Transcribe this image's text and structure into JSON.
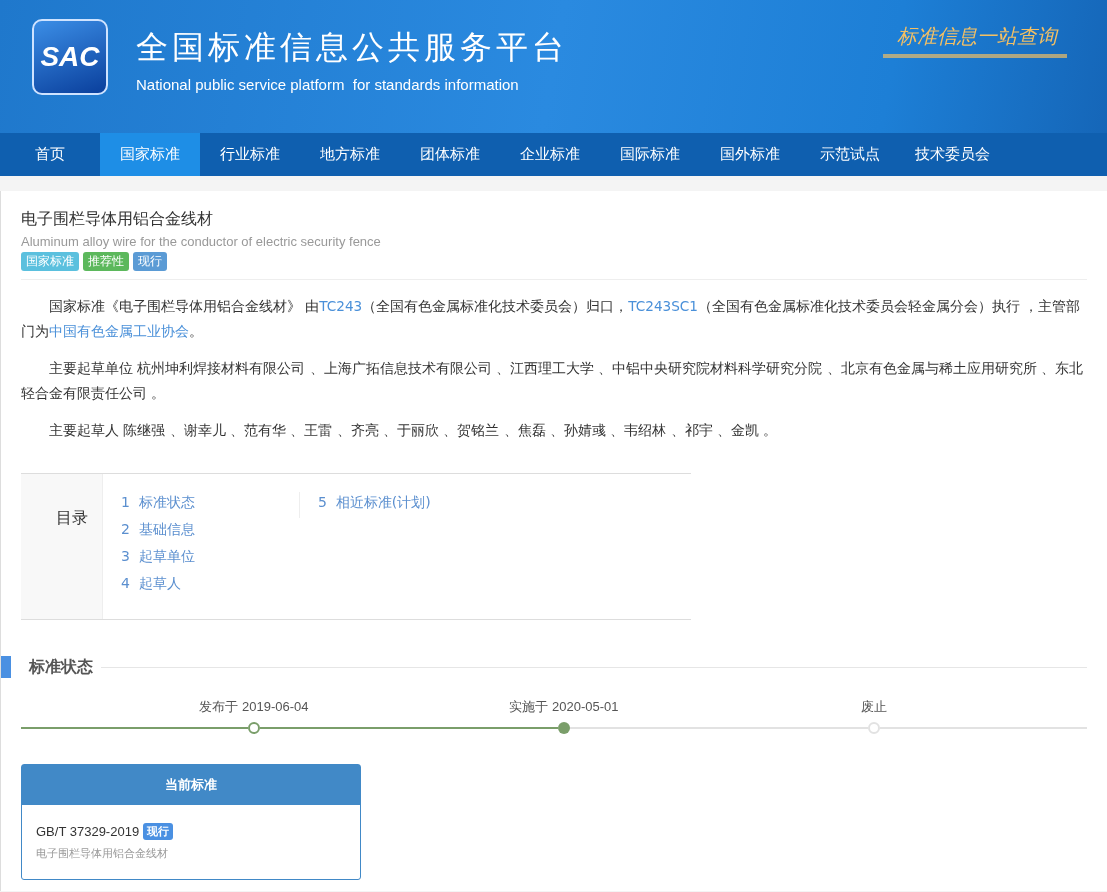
{
  "header": {
    "logo": "SAC",
    "title": "全国标准信息公共服务平台",
    "subtitle": "National public service platform  for standards information",
    "slogan": "标准信息一站查询"
  },
  "nav": [
    {
      "label": "首页",
      "selected": false
    },
    {
      "label": "国家标准",
      "selected": true
    },
    {
      "label": "行业标准",
      "selected": false
    },
    {
      "label": "地方标准",
      "selected": false
    },
    {
      "label": "团体标准",
      "selected": false
    },
    {
      "label": "企业标准",
      "selected": false
    },
    {
      "label": "国际标准",
      "selected": false
    },
    {
      "label": "国外标准",
      "selected": false
    },
    {
      "label": "示范试点",
      "selected": false
    },
    {
      "label": "技术委员会",
      "selected": false
    }
  ],
  "standard": {
    "title": "电子围栏导体用铝合金线材",
    "title_en": "Aluminum alloy wire for the conductor of electric security fence",
    "tags": [
      {
        "label": "国家标准",
        "color": "#5bc0de"
      },
      {
        "label": "推荐性",
        "color": "#5cb85c"
      },
      {
        "label": "现行",
        "color": "#5b9bd5"
      }
    ]
  },
  "paragraphs": [
    [
      {
        "text": "国家标准《电子围栏导体用铝合金线材》 由",
        "link": false
      },
      {
        "text": "TC243",
        "link": true
      },
      {
        "text": "（全国有色金属标准化技术委员会）归口，",
        "link": false
      },
      {
        "text": "TC243SC1",
        "link": true
      },
      {
        "text": "（全国有色金属标准化技术委员会轻金属分会）执行 ，主管部门为",
        "link": false
      },
      {
        "text": "中国有色金属工业协会",
        "link": true
      },
      {
        "text": "。",
        "link": false
      }
    ],
    [
      {
        "text": "主要起草单位 杭州坤利焊接材料有限公司 、上海广拓信息技术有限公司 、江西理工大学 、中铝中央研究院材料科学研究分院 、北京有色金属与稀土应用研究所 、东北轻合金有限责任公司 。",
        "link": false
      }
    ],
    [
      {
        "text": "主要起草人 陈继强 、谢幸儿 、范有华 、王雷 、齐亮 、于丽欣 、贺铭兰 、焦磊 、孙婧彧 、韦绍林 、祁宇 、金凯 。",
        "link": false
      }
    ]
  ],
  "toc": {
    "label": "目录",
    "columns": [
      [
        {
          "number": "1",
          "label": "标准状态"
        },
        {
          "number": "2",
          "label": "基础信息"
        },
        {
          "number": "3",
          "label": "起草单位"
        },
        {
          "number": "4",
          "label": "起草人"
        }
      ],
      [
        {
          "number": "5",
          "label": "相近标准(计划)"
        }
      ]
    ]
  },
  "status_section": {
    "heading": "标准状态",
    "timeline": [
      {
        "label": "发布于 2019-06-04",
        "kind": "passed"
      },
      {
        "label": "实施于 2020-05-01",
        "kind": "current"
      },
      {
        "label": "废止",
        "kind": "future"
      }
    ]
  },
  "current_card": {
    "heading": "当前标准",
    "code": "GB/T 37329-2019",
    "badge": "现行",
    "name": "电子围栏导体用铝合金线材"
  }
}
